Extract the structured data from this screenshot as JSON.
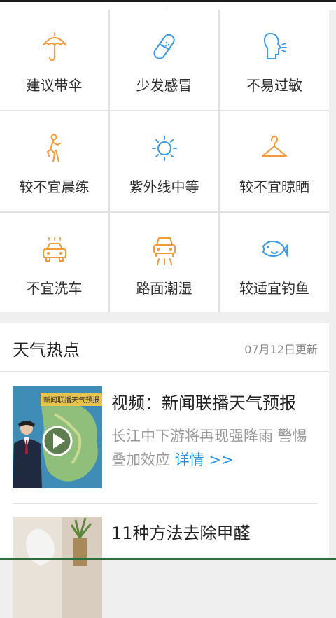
{
  "colors": {
    "icon_orange": "#f39a3a",
    "icon_blue": "#3d9be6",
    "link_blue": "#2a92e0"
  },
  "indices": [
    {
      "label": "建议带伞",
      "icon": "umbrella-icon"
    },
    {
      "label": "少发感冒",
      "icon": "pill-icon"
    },
    {
      "label": "不易过敏",
      "icon": "sneeze-icon"
    },
    {
      "label": "较不宜晨练",
      "icon": "running-icon"
    },
    {
      "label": "紫外线中等",
      "icon": "sun-icon"
    },
    {
      "label": "较不宜晾晒",
      "icon": "hanger-icon"
    },
    {
      "label": "不宜洗车",
      "icon": "car-wash-icon"
    },
    {
      "label": "路面潮湿",
      "icon": "wet-road-icon"
    },
    {
      "label": "较适宜钓鱼",
      "icon": "fish-icon"
    }
  ],
  "hot": {
    "title": "天气热点",
    "date": "07月12日更新",
    "items": [
      {
        "title": "视频：新闻联播天气预报",
        "desc": "长江中下游将再现强降雨 警惕叠加效应 ",
        "more": "详情 >>",
        "thumb_caption": "新闻联播天气预报",
        "thumb": "news-video-thumbnail"
      },
      {
        "title": "11种方法去除甲醛",
        "thumb": "room-plant-thumbnail"
      }
    ]
  }
}
